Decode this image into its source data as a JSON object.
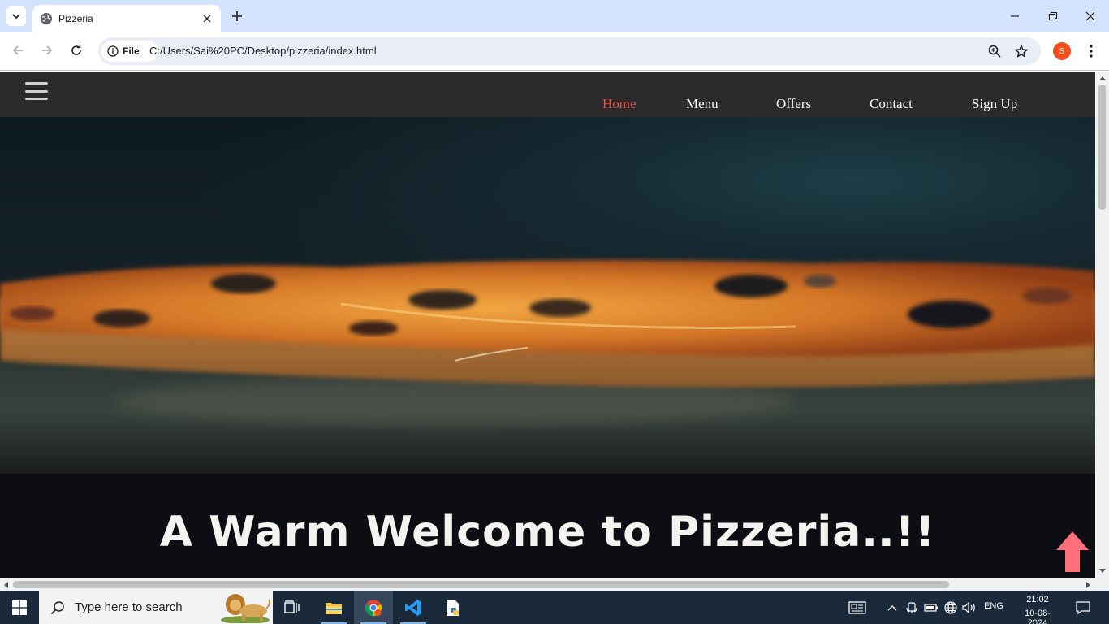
{
  "browser": {
    "tab": {
      "title": "Pizzeria"
    },
    "omnibox": {
      "site_chip_label": "File",
      "url": "C:/Users/Sai%20PC/Desktop/pizzeria/index.html"
    },
    "profile_initial": "S"
  },
  "site": {
    "nav_links": [
      {
        "label": "Home",
        "active": true
      },
      {
        "label": "Menu",
        "active": false
      },
      {
        "label": "Offers",
        "active": false
      },
      {
        "label": "Contact",
        "active": false
      },
      {
        "label": "Sign Up",
        "active": false
      }
    ],
    "welcome_heading": "A Warm Welcome to Pizzeria..!!",
    "accent_color": "#e4524a",
    "scroll_top_color": "#ff6f7a"
  },
  "taskbar": {
    "search_placeholder": "Type here to search",
    "language": "ENG",
    "time": "21:02",
    "date": "10-08-2024"
  }
}
